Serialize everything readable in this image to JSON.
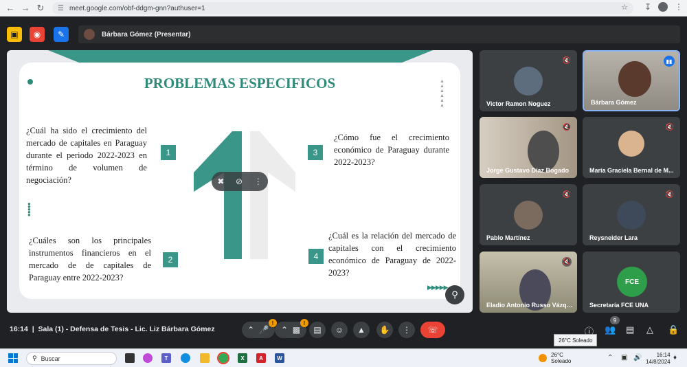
{
  "browser": {
    "url": "meet.google.com/obf-ddgm-gnn?authuser=1"
  },
  "meet_top": {
    "presenter_label": "Bárbara Gómez (Presentar)"
  },
  "slide": {
    "title": "PROBLEMAS ESPECIFICOS",
    "questions": [
      {
        "number": "1",
        "text": "¿Cuál ha sido el crecimiento del mercado de capitales en Paraguay durante el periodo 2022-2023 en término de volumen de negociación?"
      },
      {
        "number": "2",
        "text": "¿Cuáles son los principales instrumentos financieros en el mercado de de capitales de Paraguay entre 2022-2023?"
      },
      {
        "number": "3",
        "text": "¿Cómo fue el crecimiento económico de Paraguay durante 2022-2023?"
      },
      {
        "number": "4",
        "text": "¿Cuál es la relación del mercado de capitales con el crecimiento económico de Paraguay de 2022-2023?"
      }
    ],
    "colors": {
      "accent": "#2e8b7a",
      "box": "#3a9688"
    }
  },
  "participants": [
    {
      "name": "Victor Ramon Noguez",
      "muted": true
    },
    {
      "name": "Bárbara Gómez",
      "speaking": true
    },
    {
      "name": "Jorge Gustavo Díaz Bogado",
      "muted": true
    },
    {
      "name": "María Graciela Bernal de M...",
      "muted": true
    },
    {
      "name": "Pablo Martínez",
      "muted": true
    },
    {
      "name": "Reysneider Lara",
      "muted": true
    },
    {
      "name": "Eladio Antonio Russo Vázqu...",
      "muted": true
    },
    {
      "name": "Secretaría FCE UNA"
    }
  ],
  "fce_logo_text": "FCE",
  "bottom": {
    "time": "16:14",
    "meeting_title": "Sala (1) - Defensa de Tesis - Lic. Liz Bárbara Gómez",
    "mic_badge": "!",
    "cam_badge": "!",
    "people_count": "9",
    "tooltip": "26°C Soleado"
  },
  "taskbar": {
    "search_placeholder": "Buscar",
    "weather_temp": "26°C",
    "weather_desc": "Soleado",
    "time": "16:14",
    "date": "14/8/2024"
  }
}
